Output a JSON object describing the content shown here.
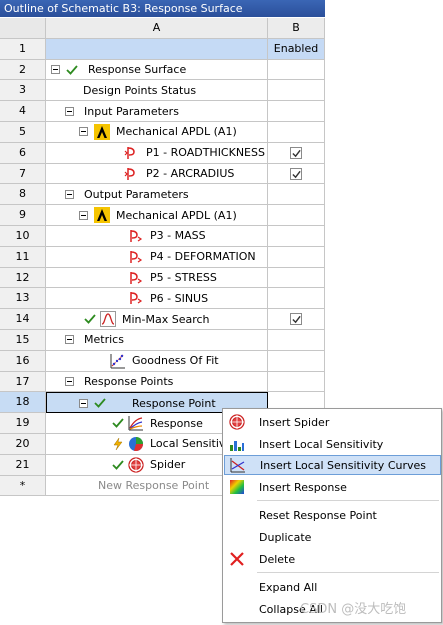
{
  "window": {
    "title": "Outline of Schematic B3: Response Surface"
  },
  "columns": {
    "a": "A",
    "b": "B"
  },
  "rows": [
    {
      "num": "1",
      "a": "",
      "b": "Enabled"
    },
    {
      "num": "2",
      "a": "Response Surface"
    },
    {
      "num": "3",
      "a": "Design Points Status"
    },
    {
      "num": "4",
      "a": "Input Parameters"
    },
    {
      "num": "5",
      "a": "Mechanical APDL (A1)"
    },
    {
      "num": "6",
      "a": "P1 - ROADTHICKNESS",
      "checked": true
    },
    {
      "num": "7",
      "a": "P2 - ARCRADIUS",
      "checked": true
    },
    {
      "num": "8",
      "a": "Output Parameters"
    },
    {
      "num": "9",
      "a": "Mechanical APDL (A1)"
    },
    {
      "num": "10",
      "a": "P3 - MASS"
    },
    {
      "num": "11",
      "a": "P4 - DEFORMATION"
    },
    {
      "num": "12",
      "a": "P5 - STRESS"
    },
    {
      "num": "13",
      "a": "P6 - SINUS"
    },
    {
      "num": "14",
      "a": "Min-Max Search",
      "checked": true
    },
    {
      "num": "15",
      "a": "Metrics"
    },
    {
      "num": "16",
      "a": "Goodness Of Fit"
    },
    {
      "num": "17",
      "a": "Response Points"
    },
    {
      "num": "18",
      "a": "Response Point"
    },
    {
      "num": "19",
      "a": "Response"
    },
    {
      "num": "20",
      "a": "Local Sensitivity"
    },
    {
      "num": "21",
      "a": "Spider"
    },
    {
      "num": "*",
      "a": "New Response Point"
    }
  ],
  "context_menu": {
    "items": [
      {
        "label": "Insert Spider",
        "icon": "spider-chart-icon"
      },
      {
        "label": "Insert Local Sensitivity",
        "icon": "bar-chart-icon"
      },
      {
        "label": "Insert Local Sensitivity Curves",
        "icon": "curves-chart-icon",
        "highlighted": true
      },
      {
        "label": "Insert Response",
        "icon": "response-surface-icon"
      },
      {
        "label": "Reset Response Point",
        "icon": ""
      },
      {
        "label": "Duplicate",
        "icon": ""
      },
      {
        "label": "Delete",
        "icon": "delete-x-icon"
      },
      {
        "label": "Expand All",
        "icon": ""
      },
      {
        "label": "Collapse All",
        "icon": ""
      }
    ]
  },
  "watermark": "CSDN @没大吃饱",
  "colors": {
    "selection": "#c7dcf4",
    "menu_highlight": "#cfe1f7",
    "title_bar": "#2b4f9a",
    "check_green": "#2e8b20"
  }
}
